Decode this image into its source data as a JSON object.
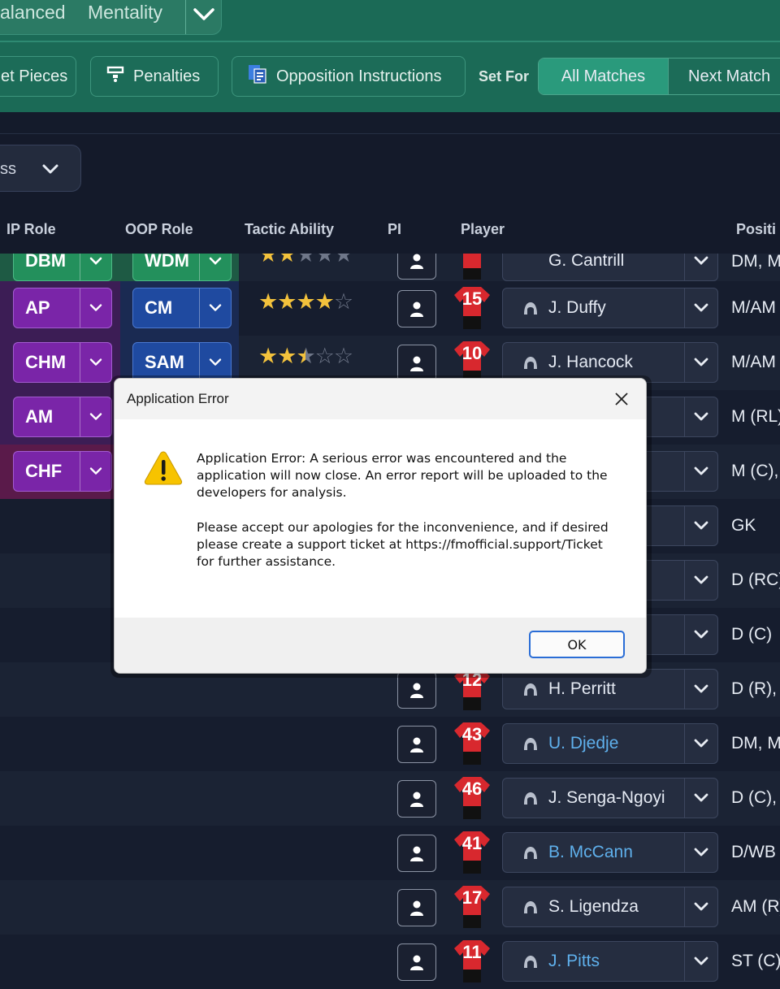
{
  "header": {
    "mentality_value": "alanced",
    "mentality_label": "Mentality",
    "buttons": {
      "set_pieces": "et Pieces",
      "penalties": "Penalties",
      "opposition": "Opposition Instructions"
    },
    "set_for_label": "Set For",
    "set_for_options": [
      "All Matches",
      "Next Match"
    ]
  },
  "filter": {
    "value": "ss"
  },
  "columns": {
    "ip_role": "IP Role",
    "oop_role": "OOP Role",
    "tactic_ability": "Tactic Ability",
    "pi": "PI",
    "player": "Player",
    "position": "Positi"
  },
  "rows": [
    {
      "ip": "AP",
      "oop": "CM",
      "ability_stars": 4,
      "shirt": "15",
      "player": "J. Duffy",
      "position": "M/AM"
    },
    {
      "ip": "CHM",
      "oop": "SAM",
      "ability_stars": 2.5,
      "shirt": "10",
      "player": "J. Hancock",
      "position": "M/AM"
    },
    {
      "ip": "AM",
      "position": "M (RL)"
    },
    {
      "ip": "CHF",
      "position": "M (C), A"
    },
    {
      "position": "GK"
    },
    {
      "position": "D (RC)"
    },
    {
      "position": "D (C)"
    },
    {
      "shirt": "12",
      "player": "H. Perritt",
      "position": "D (R), D"
    },
    {
      "shirt": "43",
      "player": "U. Djedje",
      "position": "DM, M"
    },
    {
      "shirt": "46",
      "player": "J. Senga-Ngoyi",
      "position": "D (C), D"
    },
    {
      "shirt": "41",
      "player": "B. McCann",
      "position": "D/WB"
    },
    {
      "shirt": "17",
      "player": "S. Ligendza",
      "position": "AM (R)"
    },
    {
      "shirt": "11",
      "player": "J. Pitts",
      "position": "ST (C)"
    }
  ],
  "partial_row": {
    "ip": "DBM",
    "oop": "WDM",
    "player": "G. Cantrill",
    "position": "DM, M"
  },
  "dialog": {
    "title": "Application Error",
    "message_1": "Application Error: A serious error was encountered and the application will now close. An error report will be uploaded to the developers for analysis.",
    "message_2": "Please accept our apologies for the inconvenience, and if desired please create a support ticket at https://fmofficial.support/Ticket for further assistance.",
    "ok_label": "OK"
  },
  "colors": {
    "header_green": "#1b6a56",
    "role_purple": "#7a25a8",
    "role_blue": "#1f4aa0",
    "role_green": "#23905c",
    "link_blue": "#5fb0ec",
    "shirt_red": "#d8282e"
  },
  "icons": {
    "mentality_dropdown": "chevron-down-icon",
    "penalties": "penalty-spot-icon",
    "opposition": "opposition-report-icon",
    "pi": "person-icon",
    "player_row": "player-silhouette-icon",
    "dialog_warning": "warning-icon",
    "dialog_close": "close-icon"
  }
}
